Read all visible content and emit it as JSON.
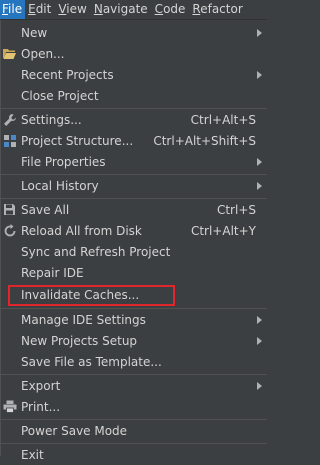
{
  "menubar": [
    {
      "label": "File",
      "mnemonic": "F",
      "rest": "ile",
      "active": true
    },
    {
      "label": "Edit",
      "mnemonic": "E",
      "rest": "dit"
    },
    {
      "label": "View",
      "mnemonic": "V",
      "rest": "iew"
    },
    {
      "label": "Navigate",
      "mnemonic": "N",
      "rest": "avigate"
    },
    {
      "label": "Code",
      "mnemonic": "C",
      "rest": "ode"
    },
    {
      "label": "Refactor",
      "mnemonic": "R",
      "rest": "efactor"
    }
  ],
  "file_menu": {
    "new": {
      "label": "New",
      "submenu": true
    },
    "open": {
      "label": "Open...",
      "icon": "folder-open-icon"
    },
    "recent_projects": {
      "label": "Recent Projects",
      "submenu": true
    },
    "close_project": {
      "label": "Close Project"
    },
    "settings": {
      "label": "Settings...",
      "shortcut": "Ctrl+Alt+S",
      "icon": "wrench-icon"
    },
    "project_structure": {
      "label": "Project Structure...",
      "shortcut": "Ctrl+Alt+Shift+S",
      "icon": "project-structure-icon"
    },
    "file_properties": {
      "label": "File Properties",
      "submenu": true
    },
    "local_history": {
      "label": "Local History",
      "submenu": true
    },
    "save_all": {
      "label": "Save All",
      "shortcut": "Ctrl+S",
      "icon": "save-icon"
    },
    "reload_from_disk": {
      "label": "Reload All from Disk",
      "shortcut": "Ctrl+Alt+Y",
      "icon": "reload-icon"
    },
    "sync_refresh": {
      "label": "Sync and Refresh Project"
    },
    "repair_ide": {
      "label": "Repair IDE"
    },
    "invalidate_caches": {
      "label": "Invalidate Caches...",
      "highlighted": true
    },
    "manage_ide_settings": {
      "label": "Manage IDE Settings",
      "submenu": true
    },
    "new_projects_setup": {
      "label": "New Projects Setup",
      "submenu": true
    },
    "save_as_template": {
      "label": "Save File as Template..."
    },
    "export": {
      "label": "Export",
      "submenu": true
    },
    "print": {
      "label": "Print...",
      "icon": "print-icon"
    },
    "power_save": {
      "label": "Power Save Mode"
    },
    "exit": {
      "label": "Exit"
    }
  },
  "colors": {
    "background": "#3c3f41",
    "menubar_active": "#2675bf",
    "separator": "#515151",
    "text": "#d4d4d4",
    "highlight_box": "#e0252c"
  }
}
